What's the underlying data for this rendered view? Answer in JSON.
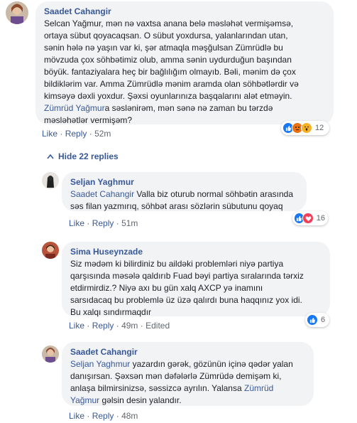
{
  "comments": [
    {
      "author": "Saadet Cahangir",
      "text": "Selcan Yağmur, mən nə vaxtsa anana belə məsləhət vermişəmsə,\nortaya sübut qoyacaqsan. O sübut yoxdursa, yalanlarından utan,\nsənin hələ nə yaşın var ki, şər atmaqla məşğulsan Zümrüdlə bu\nmövzuda çox söhbətimiz olub, amma sənin uydurduğun başından\nböyük. fantaziyalara heç bir bağlılığım olmayıb. Bəli, mənim də çox\nbildiklərim var. Amma Zümrüdlə mənim aramda olan söhbətlərdir və\nkimsəyə dəxli yoxdur. Şəxsi oyunlarınıza başqalarını alət etməyin.",
      "mention": "Zümrüd Yağmur",
      "text_after": "a səslənirəm, mən sənə nə zaman bu tərzdə\nməsləhətlər vermişəm?",
      "like": "Like",
      "reply": "Reply",
      "time": "52m",
      "reaction_count": "12"
    },
    {
      "author": "Seljan Yaghmur",
      "mention": "Saadet Cahangir",
      "text_after": " Valla biz oturub normal söhbətin arasında\nsəs filan yazmırıq, söhbət arası sözlərin sübutunu qoyaq",
      "like": "Like",
      "reply": "Reply",
      "time": "51m",
      "reaction_count": "16"
    },
    {
      "author": "Sima Huseynzade",
      "text": "Siz mədəm ki bilirdiniz bu aildəki problemləri niyə partiya\nqarşısında məsələ qaldırıb Fuad bəyi partiya sıralarında tərxiz\netdirmirdiz.? Niyə axı bu gün xalq AXCP yə inamını\nsarsıdacaq bu problemlə üz üzə qalırdı buna haqqınız yox idi.\nBu xalqı sındırmaqdır",
      "like": "Like",
      "reply": "Reply",
      "time": "49m",
      "edited": "Edited",
      "reaction_count": "6"
    },
    {
      "author": "Saadet Cahangir",
      "mention": "Seljan Yaghmur",
      "text_mid": " yazardın gərək, gözünün içinə qədər yalan\ndanışırsan. Şəxsən mən dəfələrlə Zümrüdə demişəm ki,\nanlaşa bilmirsinizsə, səssizcə ayrılın. Yalansa ",
      "mention2": "Zümrüd\nYağmur",
      "text_after": " gəlsin desin yalandır.",
      "like": "Like",
      "reply": "Reply",
      "time": "48m"
    }
  ],
  "hide_replies": "Hide 22 replies",
  "dot": "·",
  "colors": {
    "link": "#385898",
    "bubble": "#f2f3f5",
    "like": "#1877f2"
  }
}
